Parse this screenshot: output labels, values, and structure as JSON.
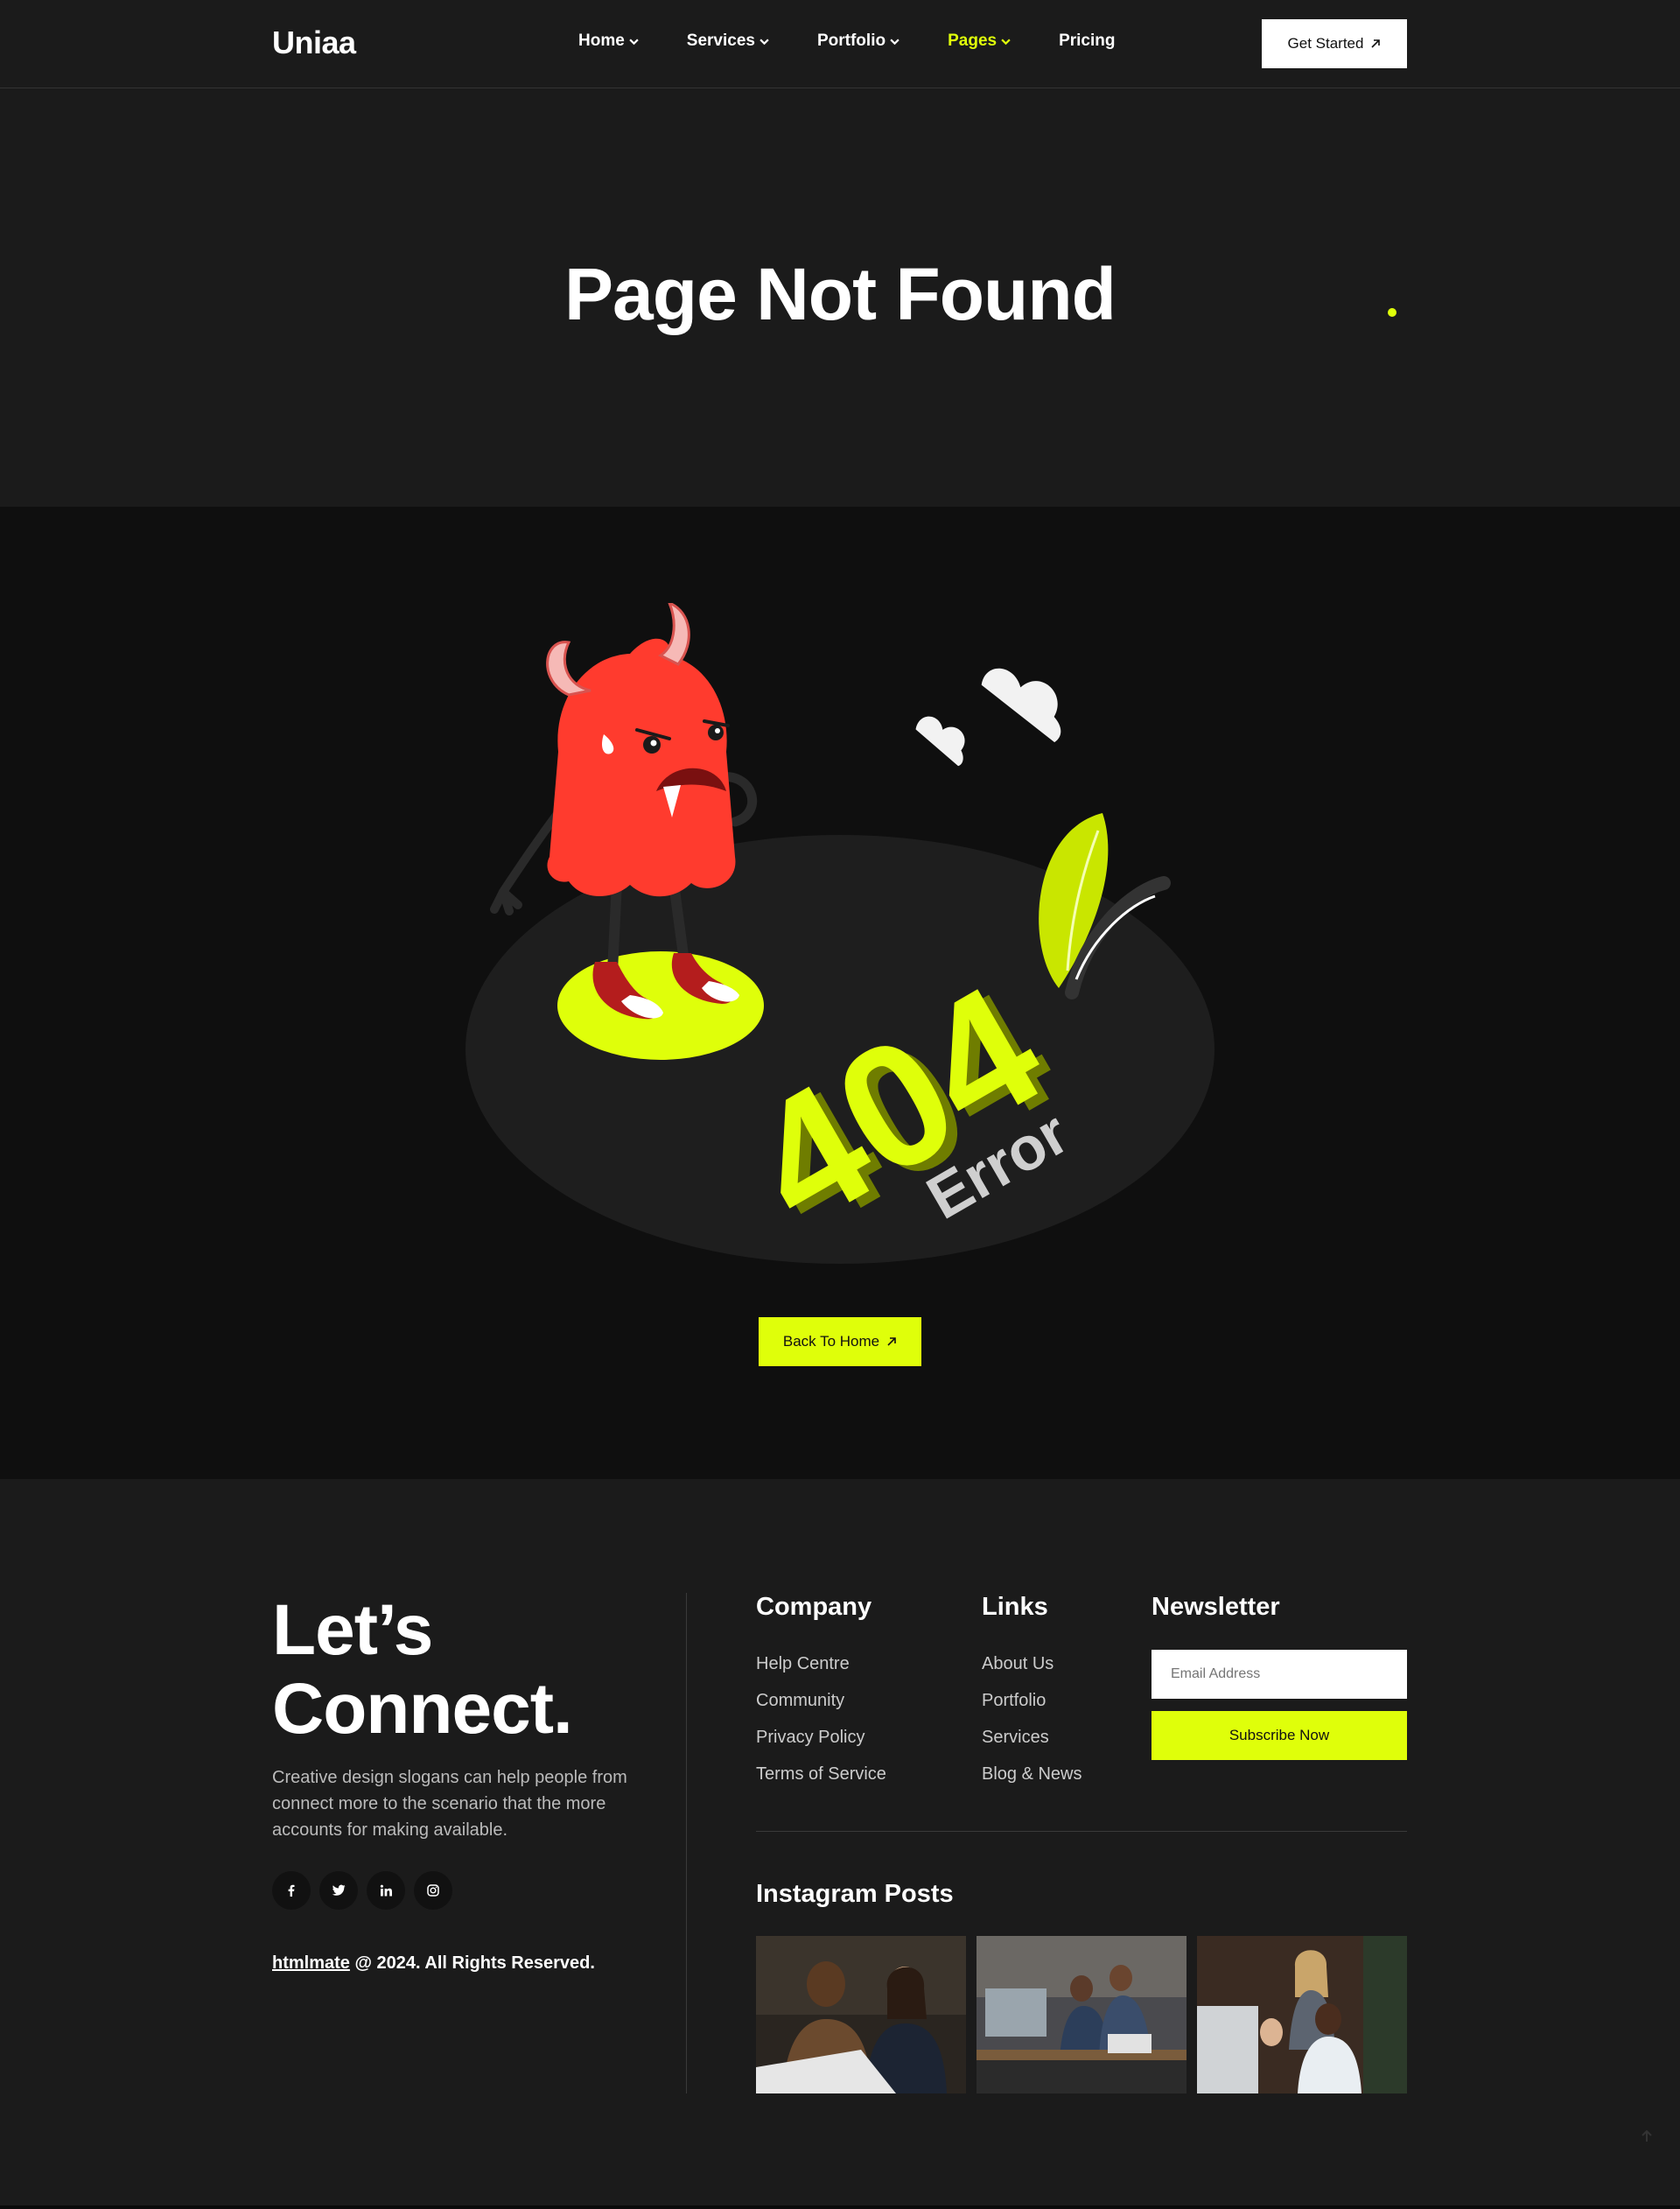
{
  "header": {
    "logo": "Uniaa",
    "nav": [
      {
        "label": "Home",
        "has_dropdown": true
      },
      {
        "label": "Services",
        "has_dropdown": true
      },
      {
        "label": "Portfolio",
        "has_dropdown": true
      },
      {
        "label": "Pages",
        "has_dropdown": true,
        "active": true
      },
      {
        "label": "Pricing",
        "has_dropdown": false
      }
    ],
    "cta": "Get Started"
  },
  "hero": {
    "title": "Page Not Found"
  },
  "error": {
    "big_text": "404",
    "small_text": "Error",
    "button": "Back To Home"
  },
  "footer": {
    "heading": "Let’s Connect.",
    "description": "Creative design slogans can help people from connect more to the scenario that the more accounts for making available.",
    "social": [
      "facebook-icon",
      "twitter-icon",
      "linkedin-icon",
      "instagram-icon"
    ],
    "copyright_link": "htmlmate",
    "copyright_rest": "@ 2024. All Rights Reserved.",
    "company": {
      "title": "Company",
      "items": [
        "Help Centre",
        "Community",
        "Privacy Policy",
        "Terms of Service"
      ]
    },
    "links": {
      "title": "Links",
      "items": [
        "About Us",
        "Portfolio",
        "Services",
        "Blog & News"
      ]
    },
    "newsletter": {
      "title": "Newsletter",
      "placeholder": "Email Address",
      "button": "Subscribe Now"
    },
    "instagram": {
      "title": "Instagram Posts",
      "count": 3
    }
  },
  "colors": {
    "accent": "#dfff0a",
    "background": "#1b1b1b",
    "dark_section": "#0f0f0f",
    "monster": "#ff3b2e"
  }
}
